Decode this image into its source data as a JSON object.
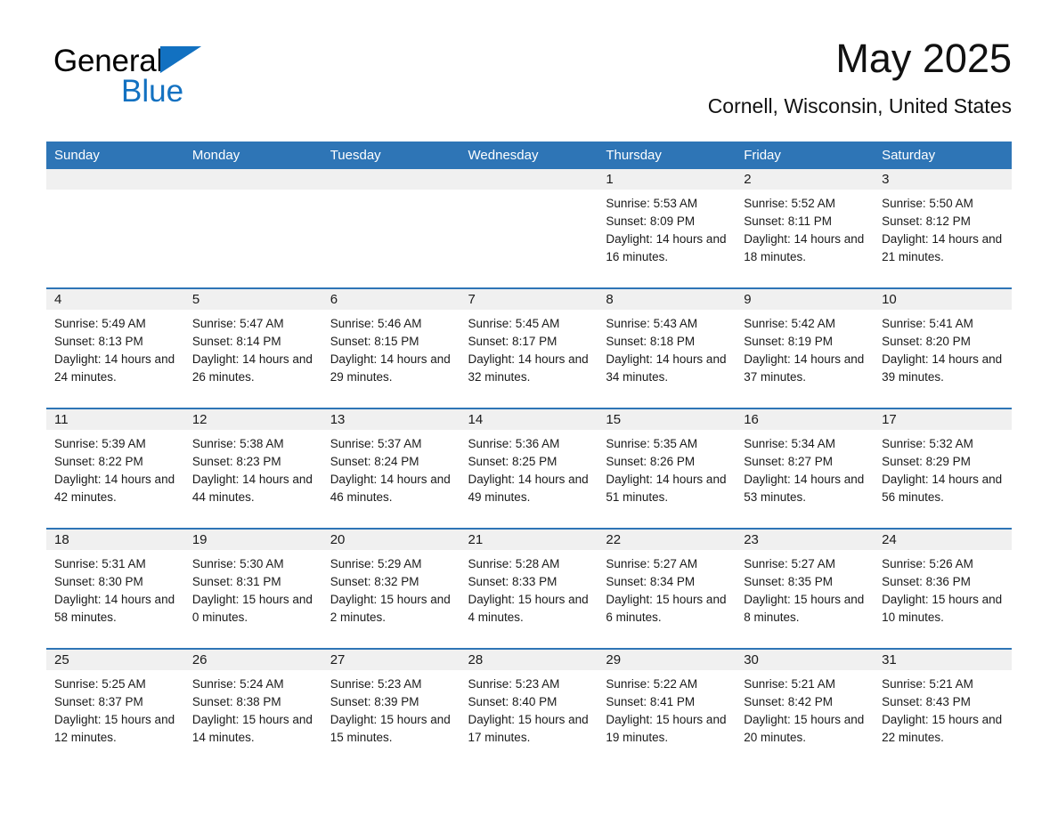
{
  "brand": {
    "word1": "General",
    "word2": "Blue",
    "triangle_icon": "brand-triangle-icon",
    "accent_color": "#1271c1"
  },
  "header": {
    "title": "May 2025",
    "subtitle": "Cornell, Wisconsin, United States"
  },
  "colors": {
    "header_blue": "#2e75b6",
    "daynum_band": "#f0f0f0",
    "text": "#1a1a1a"
  },
  "calendar": {
    "weekday_headers": [
      "Sunday",
      "Monday",
      "Tuesday",
      "Wednesday",
      "Thursday",
      "Friday",
      "Saturday"
    ],
    "weeks": [
      [
        {
          "empty": true
        },
        {
          "empty": true
        },
        {
          "empty": true
        },
        {
          "empty": true
        },
        {
          "day": "1",
          "sunrise": "Sunrise: 5:53 AM",
          "sunset": "Sunset: 8:09 PM",
          "daylight": "Daylight: 14 hours and 16 minutes."
        },
        {
          "day": "2",
          "sunrise": "Sunrise: 5:52 AM",
          "sunset": "Sunset: 8:11 PM",
          "daylight": "Daylight: 14 hours and 18 minutes."
        },
        {
          "day": "3",
          "sunrise": "Sunrise: 5:50 AM",
          "sunset": "Sunset: 8:12 PM",
          "daylight": "Daylight: 14 hours and 21 minutes."
        }
      ],
      [
        {
          "day": "4",
          "sunrise": "Sunrise: 5:49 AM",
          "sunset": "Sunset: 8:13 PM",
          "daylight": "Daylight: 14 hours and 24 minutes."
        },
        {
          "day": "5",
          "sunrise": "Sunrise: 5:47 AM",
          "sunset": "Sunset: 8:14 PM",
          "daylight": "Daylight: 14 hours and 26 minutes."
        },
        {
          "day": "6",
          "sunrise": "Sunrise: 5:46 AM",
          "sunset": "Sunset: 8:15 PM",
          "daylight": "Daylight: 14 hours and 29 minutes."
        },
        {
          "day": "7",
          "sunrise": "Sunrise: 5:45 AM",
          "sunset": "Sunset: 8:17 PM",
          "daylight": "Daylight: 14 hours and 32 minutes."
        },
        {
          "day": "8",
          "sunrise": "Sunrise: 5:43 AM",
          "sunset": "Sunset: 8:18 PM",
          "daylight": "Daylight: 14 hours and 34 minutes."
        },
        {
          "day": "9",
          "sunrise": "Sunrise: 5:42 AM",
          "sunset": "Sunset: 8:19 PM",
          "daylight": "Daylight: 14 hours and 37 minutes."
        },
        {
          "day": "10",
          "sunrise": "Sunrise: 5:41 AM",
          "sunset": "Sunset: 8:20 PM",
          "daylight": "Daylight: 14 hours and 39 minutes."
        }
      ],
      [
        {
          "day": "11",
          "sunrise": "Sunrise: 5:39 AM",
          "sunset": "Sunset: 8:22 PM",
          "daylight": "Daylight: 14 hours and 42 minutes."
        },
        {
          "day": "12",
          "sunrise": "Sunrise: 5:38 AM",
          "sunset": "Sunset: 8:23 PM",
          "daylight": "Daylight: 14 hours and 44 minutes."
        },
        {
          "day": "13",
          "sunrise": "Sunrise: 5:37 AM",
          "sunset": "Sunset: 8:24 PM",
          "daylight": "Daylight: 14 hours and 46 minutes."
        },
        {
          "day": "14",
          "sunrise": "Sunrise: 5:36 AM",
          "sunset": "Sunset: 8:25 PM",
          "daylight": "Daylight: 14 hours and 49 minutes."
        },
        {
          "day": "15",
          "sunrise": "Sunrise: 5:35 AM",
          "sunset": "Sunset: 8:26 PM",
          "daylight": "Daylight: 14 hours and 51 minutes."
        },
        {
          "day": "16",
          "sunrise": "Sunrise: 5:34 AM",
          "sunset": "Sunset: 8:27 PM",
          "daylight": "Daylight: 14 hours and 53 minutes."
        },
        {
          "day": "17",
          "sunrise": "Sunrise: 5:32 AM",
          "sunset": "Sunset: 8:29 PM",
          "daylight": "Daylight: 14 hours and 56 minutes."
        }
      ],
      [
        {
          "day": "18",
          "sunrise": "Sunrise: 5:31 AM",
          "sunset": "Sunset: 8:30 PM",
          "daylight": "Daylight: 14 hours and 58 minutes."
        },
        {
          "day": "19",
          "sunrise": "Sunrise: 5:30 AM",
          "sunset": "Sunset: 8:31 PM",
          "daylight": "Daylight: 15 hours and 0 minutes."
        },
        {
          "day": "20",
          "sunrise": "Sunrise: 5:29 AM",
          "sunset": "Sunset: 8:32 PM",
          "daylight": "Daylight: 15 hours and 2 minutes."
        },
        {
          "day": "21",
          "sunrise": "Sunrise: 5:28 AM",
          "sunset": "Sunset: 8:33 PM",
          "daylight": "Daylight: 15 hours and 4 minutes."
        },
        {
          "day": "22",
          "sunrise": "Sunrise: 5:27 AM",
          "sunset": "Sunset: 8:34 PM",
          "daylight": "Daylight: 15 hours and 6 minutes."
        },
        {
          "day": "23",
          "sunrise": "Sunrise: 5:27 AM",
          "sunset": "Sunset: 8:35 PM",
          "daylight": "Daylight: 15 hours and 8 minutes."
        },
        {
          "day": "24",
          "sunrise": "Sunrise: 5:26 AM",
          "sunset": "Sunset: 8:36 PM",
          "daylight": "Daylight: 15 hours and 10 minutes."
        }
      ],
      [
        {
          "day": "25",
          "sunrise": "Sunrise: 5:25 AM",
          "sunset": "Sunset: 8:37 PM",
          "daylight": "Daylight: 15 hours and 12 minutes."
        },
        {
          "day": "26",
          "sunrise": "Sunrise: 5:24 AM",
          "sunset": "Sunset: 8:38 PM",
          "daylight": "Daylight: 15 hours and 14 minutes."
        },
        {
          "day": "27",
          "sunrise": "Sunrise: 5:23 AM",
          "sunset": "Sunset: 8:39 PM",
          "daylight": "Daylight: 15 hours and 15 minutes."
        },
        {
          "day": "28",
          "sunrise": "Sunrise: 5:23 AM",
          "sunset": "Sunset: 8:40 PM",
          "daylight": "Daylight: 15 hours and 17 minutes."
        },
        {
          "day": "29",
          "sunrise": "Sunrise: 5:22 AM",
          "sunset": "Sunset: 8:41 PM",
          "daylight": "Daylight: 15 hours and 19 minutes."
        },
        {
          "day": "30",
          "sunrise": "Sunrise: 5:21 AM",
          "sunset": "Sunset: 8:42 PM",
          "daylight": "Daylight: 15 hours and 20 minutes."
        },
        {
          "day": "31",
          "sunrise": "Sunrise: 5:21 AM",
          "sunset": "Sunset: 8:43 PM",
          "daylight": "Daylight: 15 hours and 22 minutes."
        }
      ]
    ]
  }
}
